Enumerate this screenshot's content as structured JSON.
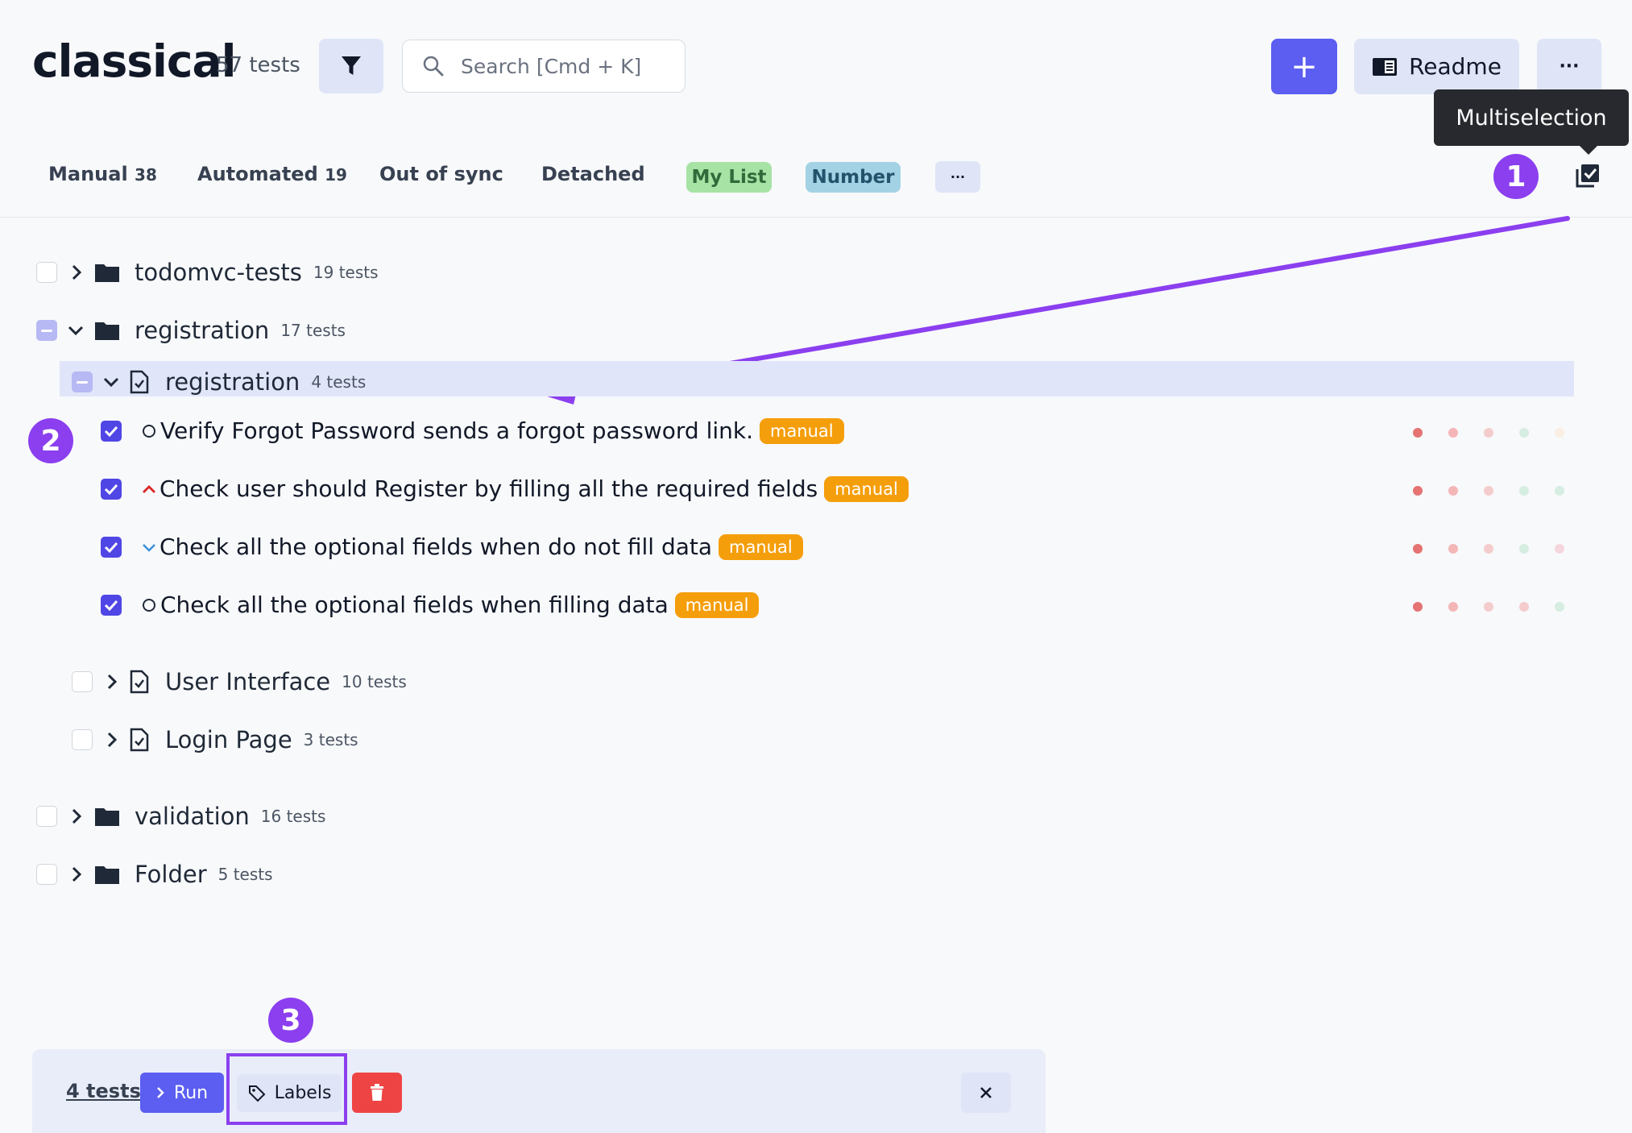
{
  "header": {
    "project_title": "classical",
    "project_count": "57 tests",
    "search_placeholder": "Search [Cmd + K]",
    "add_label": "+",
    "readme_label": "Readme",
    "more_label": "···",
    "tooltip": "Multiselection"
  },
  "tabs": {
    "manual": {
      "label": "Manual",
      "count": "38"
    },
    "automated": {
      "label": "Automated",
      "count": "19"
    },
    "out_of_sync": "Out of sync",
    "detached": "Detached",
    "my_list": "My List",
    "number": "Number",
    "more": "···"
  },
  "annotations": {
    "one": "1",
    "two": "2",
    "three": "3"
  },
  "tree": {
    "todomvc": {
      "name": "todomvc-tests",
      "count": "19 tests"
    },
    "registration_folder": {
      "name": "registration",
      "count": "17 tests"
    },
    "registration_suite": {
      "name": "registration",
      "count": "4 tests"
    },
    "user_interface": {
      "name": "User Interface",
      "count": "10 tests"
    },
    "login_page": {
      "name": "Login Page",
      "count": "3 tests"
    },
    "validation": {
      "name": "validation",
      "count": "16 tests"
    },
    "folder": {
      "name": "Folder",
      "count": "5 tests"
    }
  },
  "tests": [
    {
      "priority": "normal",
      "title": "Verify Forgot Password sends a forgot password link.",
      "tag": "manual",
      "history": [
        "#e57373",
        "#f4b6b6",
        "#f5cccc",
        "#d6ede2",
        "#fbeee2"
      ]
    },
    {
      "priority": "high",
      "title": "Check user should Register by filling all the required fields",
      "tag": "manual",
      "history": [
        "#e57373",
        "#f4b6b6",
        "#f5cccc",
        "#d6ede2",
        "#d6ede2"
      ]
    },
    {
      "priority": "low",
      "title": "Check all the optional fields when do not fill data",
      "tag": "manual",
      "history": [
        "#e57373",
        "#f4b6b6",
        "#f5cccc",
        "#d6ede2",
        "#f5d6dc"
      ]
    },
    {
      "priority": "normal",
      "title": "Check all the optional fields when filling data",
      "tag": "manual",
      "history": [
        "#e57373",
        "#f4b6b6",
        "#f5cccc",
        "#f5cccc",
        "#d6ede2"
      ]
    }
  ],
  "bottom_bar": {
    "selected": "4 tests",
    "run_label": "Run",
    "labels_label": "Labels"
  },
  "colors": {
    "accent": "#5b5ef0",
    "annotation": "#8b3fef",
    "manual_tag": "#f59e0b",
    "my_list_chip": "#a7e3a5",
    "number_chip": "#a3d2e4",
    "delete": "#ef4444"
  }
}
